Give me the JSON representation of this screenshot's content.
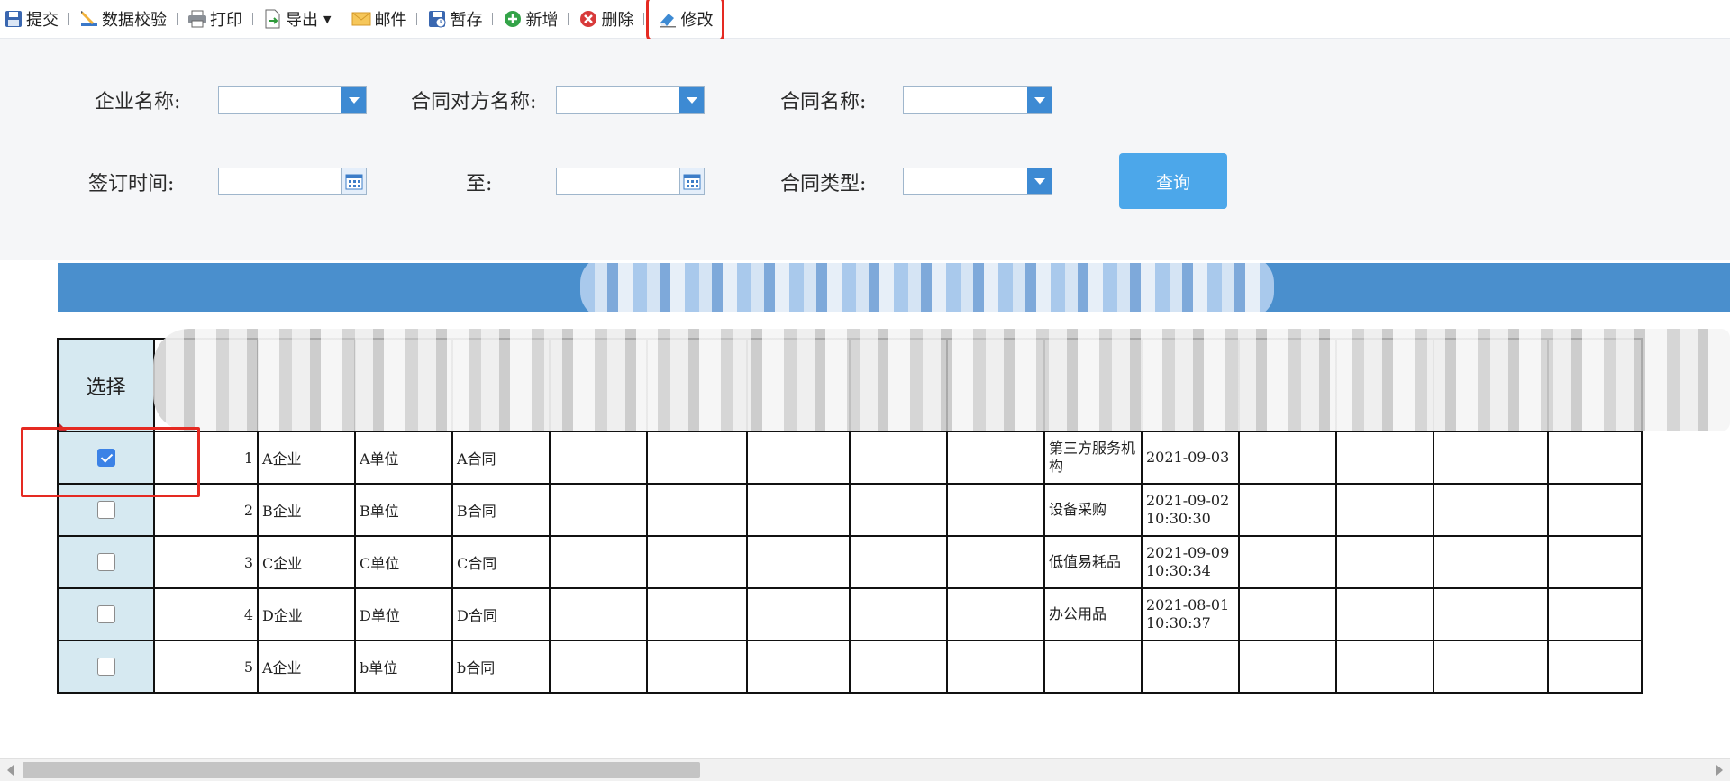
{
  "toolbar": {
    "submit": "提交",
    "validate": "数据校验",
    "print": "打印",
    "export": "导出",
    "mail": "邮件",
    "draft": "暂存",
    "add": "新增",
    "delete": "删除",
    "modify": "修改"
  },
  "filters": {
    "company_label": "企业名称:",
    "counterparty_label": "合同对方名称:",
    "contract_name_label": "合同名称:",
    "sign_time_label": "签订时间:",
    "to_label": "至:",
    "contract_type_label": "合同类型:",
    "query_button": "查询"
  },
  "table": {
    "select_header": "选择",
    "rows": [
      {
        "checked": true,
        "no": "1",
        "company": "A企业",
        "unit": "A单位",
        "contract": "A合同",
        "category": "第三方服务机构",
        "date1": "2021-09-03",
        "date2": ""
      },
      {
        "checked": false,
        "no": "2",
        "company": "B企业",
        "unit": "B单位",
        "contract": "B合同",
        "category": "设备采购",
        "date1": "2021-09-02",
        "date2": "10:30:30"
      },
      {
        "checked": false,
        "no": "3",
        "company": "C企业",
        "unit": "C单位",
        "contract": "C合同",
        "category": "低值易耗品",
        "date1": "2021-09-09",
        "date2": "10:30:34"
      },
      {
        "checked": false,
        "no": "4",
        "company": "D企业",
        "unit": "D单位",
        "contract": "D合同",
        "category": "办公用品",
        "date1": "2021-08-01",
        "date2": "10:30:37"
      },
      {
        "checked": false,
        "no": "5",
        "company": "A企业",
        "unit": "b单位",
        "contract": "b合同",
        "category": "",
        "date1": "",
        "date2": ""
      }
    ]
  },
  "colors": {
    "title_bar": "#4a8fcd",
    "query_button": "#4ca7ea",
    "select_column": "#d6e9f1",
    "highlight": "#e52a22"
  }
}
